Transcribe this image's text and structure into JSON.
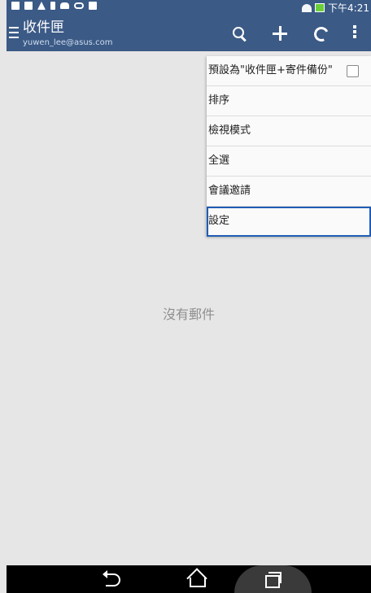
{
  "status_bar": {
    "time": "下午4:21",
    "icons_left": [
      "notification-icon",
      "mail-icon",
      "warning-icon",
      "download-icon",
      "cloud-icon",
      "infinity-icon",
      "calendar-icon"
    ],
    "icons_right": [
      "wifi-icon",
      "battery-icon"
    ]
  },
  "app_bar": {
    "title": "收件匣",
    "account": "yuwen_lee@asus.com",
    "actions": [
      "search-icon",
      "add-icon",
      "refresh-icon",
      "more-icon"
    ]
  },
  "overflow_menu": {
    "items": [
      {
        "label": "預設為\"收件匣+寄件備份\"",
        "has_checkbox": true,
        "checked": false
      },
      {
        "label": "排序"
      },
      {
        "label": "檢視模式"
      },
      {
        "label": "全選"
      },
      {
        "label": "會議邀請"
      },
      {
        "label": "設定",
        "selected": true
      }
    ]
  },
  "content": {
    "empty_text": "沒有郵件"
  },
  "nav_bar": {
    "buttons": [
      "back-icon",
      "home-icon",
      "recent-apps-icon"
    ]
  },
  "colors": {
    "app_bar": "#3b5a86",
    "background": "#e6e6e6",
    "selection_outline": "#1f5db3"
  }
}
